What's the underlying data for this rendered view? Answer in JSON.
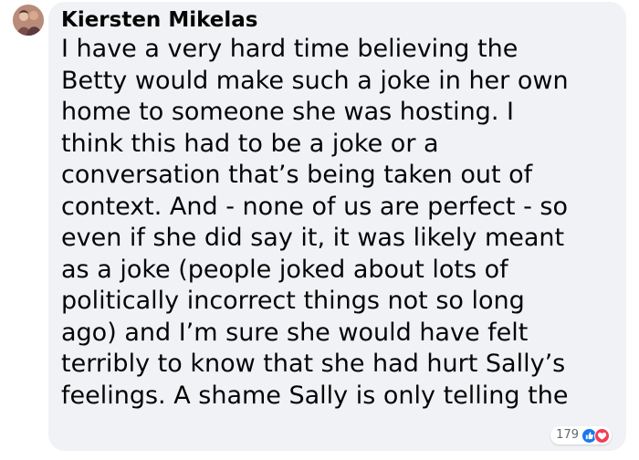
{
  "comment": {
    "author": "Kiersten Mikelas",
    "lines": [
      "I have a very hard time believing the",
      "Betty would make such a joke in her own",
      "home to someone she was hosting. I",
      "think this had to be a joke or a",
      "conversation that’s being taken out of",
      "context. And - none of us are perfect - so",
      "even if she did say it, it was likely meant",
      "as a joke (people joked about lots of",
      "politically incorrect things not so long",
      "ago) and I’m sure she would have felt",
      "terribly to know that she had hurt Sally’s",
      "feelings. A shame Sally is only telling the"
    ],
    "reactions": {
      "count": "179",
      "icons": [
        "like-icon",
        "heart-icon"
      ],
      "like_color": "#1877f2",
      "heart_color": "#f33e58"
    }
  },
  "colors": {
    "bubble_background": "#f0f2f5",
    "text": "#050505"
  }
}
